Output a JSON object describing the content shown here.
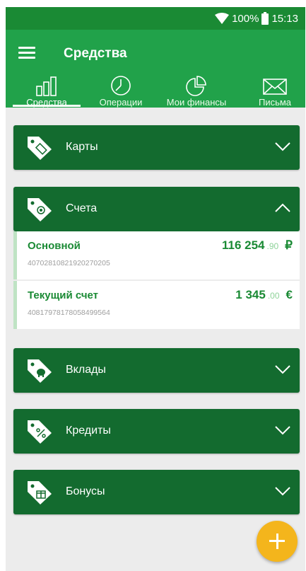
{
  "status_bar": {
    "battery": "100%",
    "time": "15:13"
  },
  "app_bar": {
    "title": "Средства"
  },
  "tabs": [
    {
      "label": "Средства",
      "icon": "bar-chart-icon",
      "active": true
    },
    {
      "label": "Операции",
      "icon": "clock-icon",
      "active": false
    },
    {
      "label": "Мои финансы",
      "icon": "pie-chart-icon",
      "active": false
    },
    {
      "label": "Письма",
      "icon": "envelope-icon",
      "active": false
    }
  ],
  "sections": [
    {
      "label": "Карты",
      "icon": "card-tag-icon",
      "expanded": false
    },
    {
      "label": "Счета",
      "icon": "money-tag-icon",
      "expanded": true
    },
    {
      "label": "Вклады",
      "icon": "piggy-bank-tag-icon",
      "expanded": false
    },
    {
      "label": "Кредиты",
      "icon": "percent-tag-icon",
      "expanded": false
    },
    {
      "label": "Бонусы",
      "icon": "gift-tag-icon",
      "expanded": false
    }
  ],
  "accounts": [
    {
      "name": "Основной",
      "number": "40702810821920270205",
      "amount_int": "116 254",
      "amount_dec": ".90",
      "currency": "₽"
    },
    {
      "name": "Текущий счет",
      "number": "40817978178058499564",
      "amount_int": "1 345",
      "amount_dec": ".00",
      "currency": "€"
    }
  ],
  "fab": {
    "icon": "plus-icon"
  },
  "colors": {
    "status_bar": "#1a8a34",
    "app_bar": "#21a24a",
    "section": "#136b2f",
    "accent": "#f4b51c",
    "background": "#ececec"
  }
}
